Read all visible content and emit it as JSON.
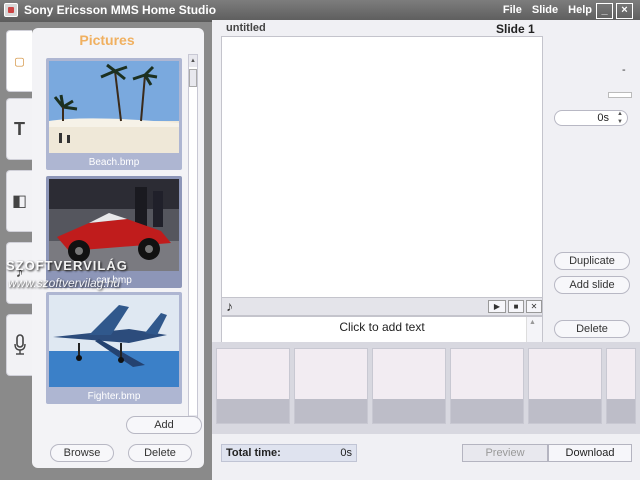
{
  "app": {
    "title": "Sony Ericsson MMS Home Studio"
  },
  "menu": {
    "file": "File",
    "slide": "Slide",
    "help": "Help"
  },
  "window": {
    "minimize": "_",
    "close": "×"
  },
  "sidetabs": [
    {
      "icon": "picture-tab-icon",
      "glyph": "▢"
    },
    {
      "icon": "text-tab-icon",
      "glyph": "T"
    },
    {
      "icon": "frame-tab-icon",
      "glyph": "◧"
    },
    {
      "icon": "sound-tab-icon",
      "glyph": "♪"
    },
    {
      "icon": "microphone-tab-icon",
      "glyph": "🎙"
    }
  ],
  "pictures": {
    "title": "Pictures",
    "items": [
      {
        "caption": "Beach.bmp"
      },
      {
        "caption": "car.bmp"
      },
      {
        "caption": "Fighter.bmp"
      }
    ],
    "add_label": "Add",
    "browse_label": "Browse",
    "delete_label": "Delete"
  },
  "editor": {
    "name": "untitled",
    "slide_label": "Slide 1",
    "text_placeholder": "Click to add text",
    "duration": "0s",
    "duplicate_label": "Duplicate",
    "add_slide_label": "Add slide",
    "delete_label": "Delete",
    "right_dash": "-"
  },
  "footer": {
    "total_label": "Total time:",
    "total_value": "0s",
    "preview_label": "Preview",
    "download_label": "Download"
  },
  "watermark": {
    "line1": "SZOFTVERVILÁG",
    "line2": "www.szoftvervilag.hu"
  }
}
